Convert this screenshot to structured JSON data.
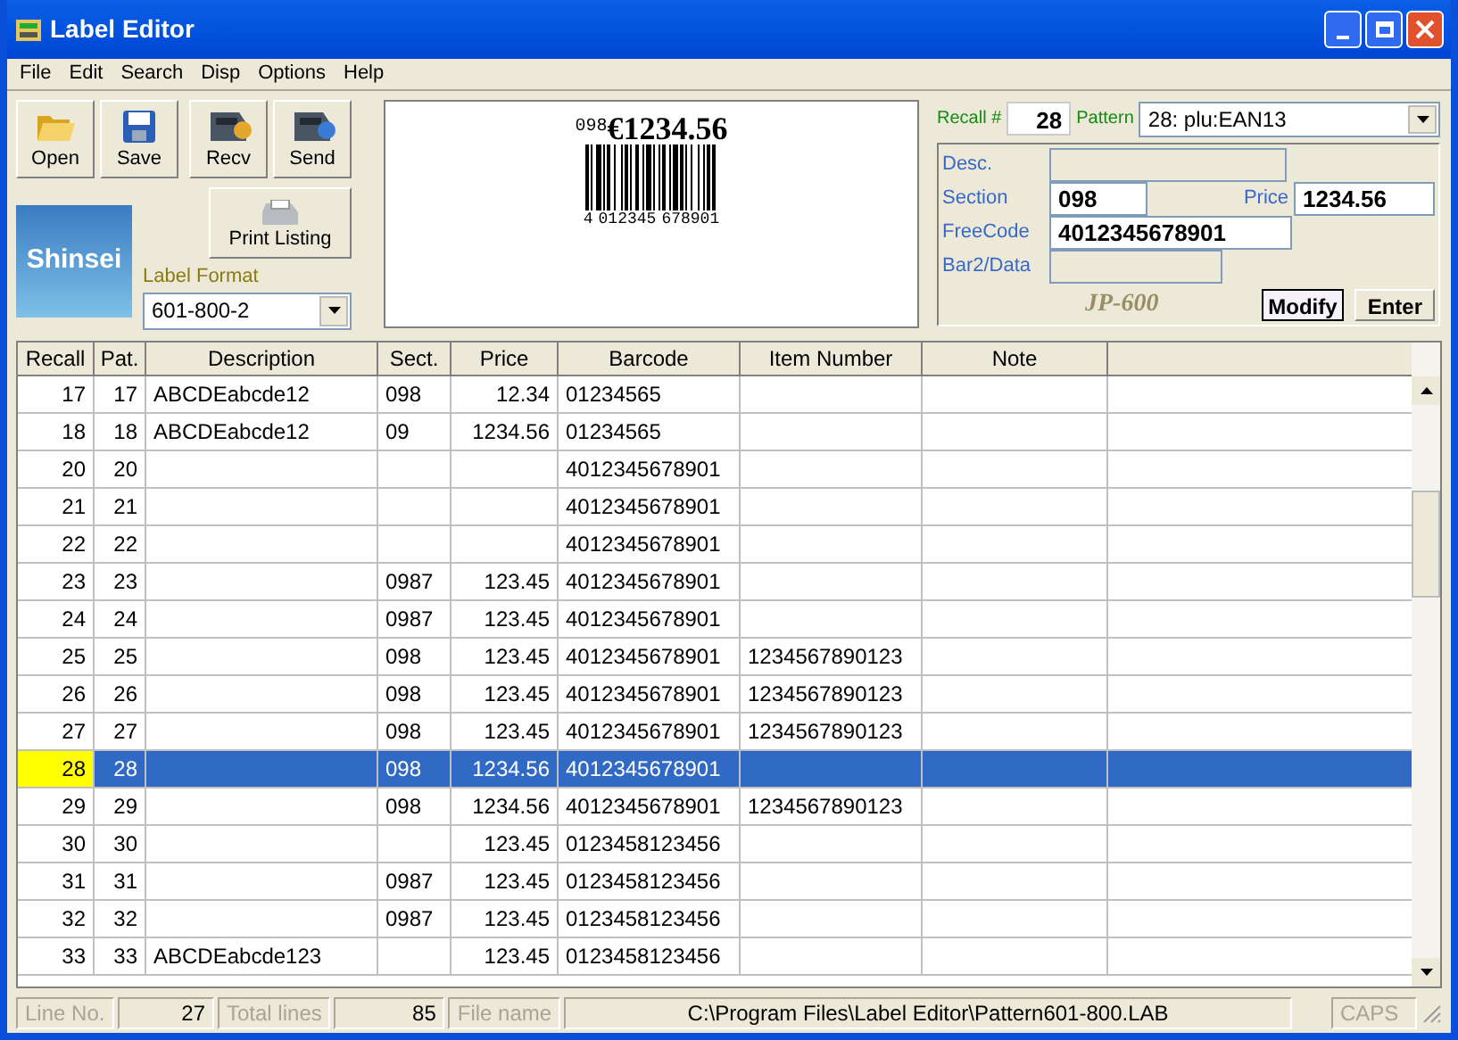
{
  "window": {
    "title": "Label Editor"
  },
  "menu": [
    "File",
    "Edit",
    "Search",
    "Disp",
    "Options",
    "Help"
  ],
  "toolbar": [
    {
      "kind": "open",
      "label": "Open"
    },
    {
      "kind": "save",
      "label": "Save"
    },
    {
      "kind": "recv",
      "label": "Recv"
    },
    {
      "kind": "send",
      "label": "Send"
    }
  ],
  "logo": "Shinsei",
  "print_button": "Print Listing",
  "label_format": {
    "label": "Label Format",
    "value": "601-800-2"
  },
  "preview": {
    "section": "098",
    "price": "€1234.56",
    "digits": [
      "4",
      "012345",
      "678901"
    ]
  },
  "recall": {
    "label": "Recall #",
    "value": "28"
  },
  "pattern": {
    "label": "Pattern",
    "value": "28: plu:EAN13"
  },
  "fields": [
    {
      "label": "Desc.",
      "disabled": true
    },
    {
      "label": "Section",
      "value": "098",
      "disabled": false
    },
    {
      "label": "FreeCode",
      "value": "4012345678901",
      "disabled": false
    },
    {
      "label": "Bar2/Data",
      "disabled": true
    }
  ],
  "price_field": {
    "label": "Price",
    "value": "1234.56"
  },
  "model": "JP-600",
  "buttons": [
    {
      "label": "Modify",
      "focused": true
    },
    {
      "label": "Enter",
      "focused": false
    }
  ],
  "table": {
    "columns": [
      "Recall",
      "Pat.",
      "Description",
      "Sect.",
      "Price",
      "Barcode",
      "Item Number",
      "Note"
    ],
    "rows": [
      {
        "recall": "17",
        "pat": "17",
        "description": "ABCDEabcde12",
        "sect": "098",
        "price": "12.34",
        "barcode": "01234565",
        "selected": false
      },
      {
        "recall": "18",
        "pat": "18",
        "description": "ABCDEabcde12",
        "sect": "09",
        "price": "1234.56",
        "barcode": "01234565",
        "selected": false
      },
      {
        "recall": "20",
        "pat": "20",
        "barcode": "4012345678901",
        "selected": false
      },
      {
        "recall": "21",
        "pat": "21",
        "barcode": "4012345678901",
        "selected": false
      },
      {
        "recall": "22",
        "pat": "22",
        "barcode": "4012345678901",
        "selected": false
      },
      {
        "recall": "23",
        "pat": "23",
        "sect": "0987",
        "price": "123.45",
        "barcode": "4012345678901",
        "selected": false
      },
      {
        "recall": "24",
        "pat": "24",
        "sect": "0987",
        "price": "123.45",
        "barcode": "4012345678901",
        "selected": false
      },
      {
        "recall": "25",
        "pat": "25",
        "sect": "098",
        "price": "123.45",
        "barcode": "4012345678901",
        "item_number": "1234567890123",
        "selected": false
      },
      {
        "recall": "26",
        "pat": "26",
        "sect": "098",
        "price": "123.45",
        "barcode": "4012345678901",
        "item_number": "1234567890123",
        "selected": false
      },
      {
        "recall": "27",
        "pat": "27",
        "sect": "098",
        "price": "123.45",
        "barcode": "4012345678901",
        "item_number": "1234567890123",
        "selected": false
      },
      {
        "recall": "28",
        "pat": "28",
        "sect": "098",
        "price": "1234.56",
        "barcode": "4012345678901",
        "selected": true
      },
      {
        "recall": "29",
        "pat": "29",
        "sect": "098",
        "price": "1234.56",
        "barcode": "4012345678901",
        "item_number": "1234567890123",
        "selected": false
      },
      {
        "recall": "30",
        "pat": "30",
        "price": "123.45",
        "barcode": "0123458123456",
        "selected": false
      },
      {
        "recall": "31",
        "pat": "31",
        "sect": "0987",
        "price": "123.45",
        "barcode": "0123458123456",
        "selected": false
      },
      {
        "recall": "32",
        "pat": "32",
        "sect": "0987",
        "price": "123.45",
        "barcode": "0123458123456",
        "selected": false
      },
      {
        "recall": "33",
        "pat": "33",
        "description": "ABCDEabcde123",
        "price": "123.45",
        "barcode": "0123458123456",
        "selected": false
      }
    ]
  },
  "status_bar": [
    {
      "kind": "label",
      "text": "Line No."
    },
    {
      "kind": "value",
      "text": "27"
    },
    {
      "kind": "label",
      "text": "Total lines"
    },
    {
      "kind": "value",
      "text": "85"
    },
    {
      "kind": "label",
      "text": "File name"
    },
    {
      "kind": "path",
      "text": "C:\\Program Files\\Label Editor\\Pattern601-800.LAB"
    },
    {
      "kind": "label",
      "text": "CAPS"
    }
  ]
}
